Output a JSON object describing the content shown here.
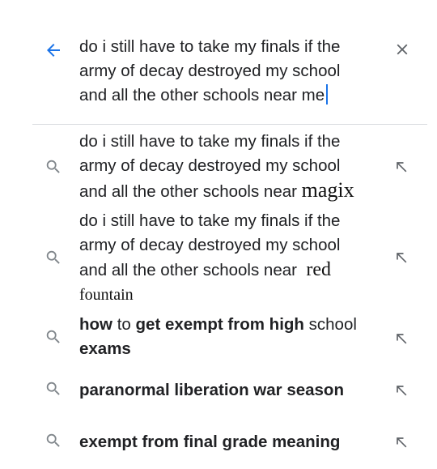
{
  "colors": {
    "accent": "#1a73e8",
    "text": "#202124",
    "icon": "#5f6368",
    "divider": "#dadce0"
  },
  "search": {
    "back_icon": "arrow-left-icon",
    "query_lines": [
      "do i still have to take my finals if the",
      "army of decay destroyed my school",
      "and all the other schools near me"
    ],
    "clear_icon": "close-icon"
  },
  "suggestions": [
    {
      "lines": [
        "do i still have to take my finals if the",
        "army of decay destroyed my school",
        "and all the other schools near"
      ],
      "edited_word": "magix"
    },
    {
      "lines": [
        "do i still have to take my finals if the",
        "army of decay destroyed my school",
        "and all the other schools near"
      ],
      "edited_word_1": "red",
      "edited_word_2": "fountain"
    },
    {
      "bold_1": "how",
      "plain_1": "to",
      "bold_2": "get exempt from high",
      "plain_2": "school",
      "bold_3": "exams"
    },
    {
      "text": "paranormal liberation war season"
    },
    {
      "text": "exempt from final grade meaning"
    }
  ],
  "icons": {
    "suggestion_icon": "search-icon",
    "fill_icon": "arrow-up-left-icon"
  }
}
